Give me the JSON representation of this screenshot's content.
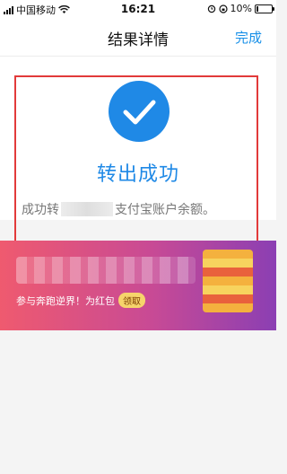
{
  "status_bar": {
    "carrier": "中国移动",
    "time": "16:21",
    "battery": "10%",
    "battery_level": 0.1,
    "icons": [
      "signal-bars-icon",
      "wifi-icon",
      "alarm-icon",
      "rotation-lock-icon",
      "battery-icon"
    ]
  },
  "nav": {
    "title": "结果详情",
    "done_label": "完成",
    "accent": "#1890e8"
  },
  "result": {
    "icon": "check-icon",
    "title": "转出成功",
    "desc_prefix": "成功转",
    "desc_suffix": "支付宝账户余额。",
    "color": "#1f89e6"
  },
  "banner": {
    "text": "参与奔跑逆界！为红包",
    "button_label": "领取"
  }
}
